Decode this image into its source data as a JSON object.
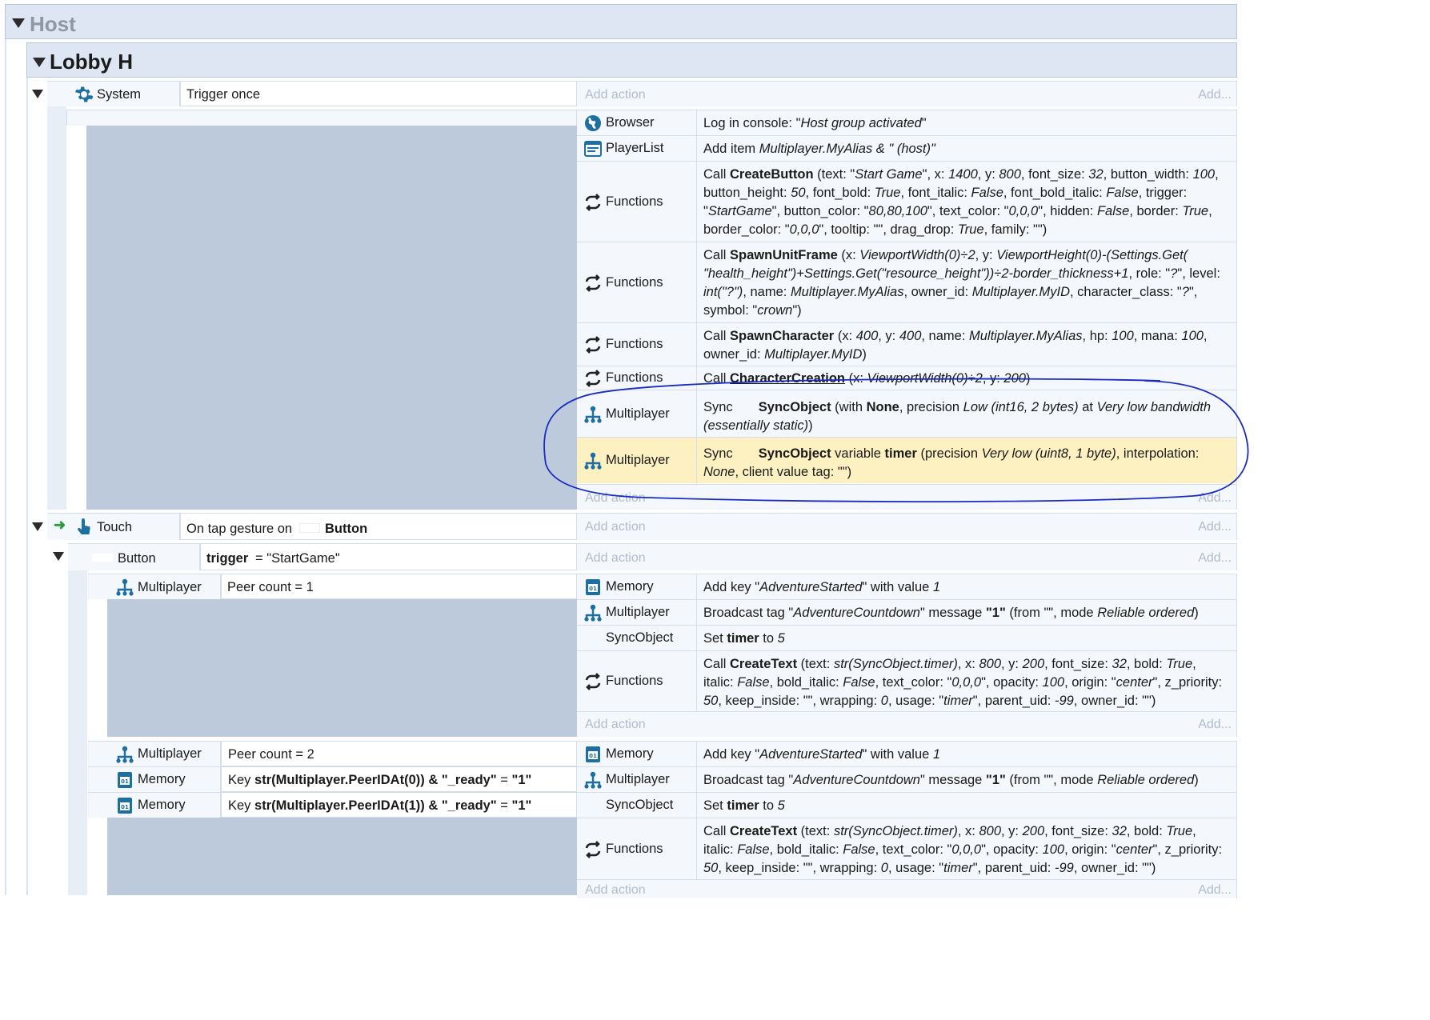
{
  "groups": {
    "host": "Host",
    "lobby": "Lobby H"
  },
  "add_action": "Add action",
  "add_short": "Add...",
  "event1": {
    "object": "System",
    "condition": "Trigger once",
    "actions": [
      {
        "object": "Browser",
        "icon": "globe-icon",
        "text": "Log in console: \"<i>Host group activated</i>\""
      },
      {
        "object": "PlayerList",
        "icon": "list-window-icon",
        "text": "Add item <i>Multiplayer.MyAlias &amp; \" (host)\"</i>"
      },
      {
        "object": "Functions",
        "icon": "functions-icon",
        "text": "Call <b>CreateButton</b> (text: \"<i>Start Game</i>\", x: <i>1400</i>, y: <i>800</i>, font_size: <i>32</i>, button_width: <i>100</i>, button_height: <i>50</i>, font_bold: <i>True</i>, font_italic: <i>False</i>, font_bold_italic: <i>False</i>, trigger: \"<i>StartGame</i>\", button_color: \"<i>80,80,100</i>\", text_color: \"<i>0,0,0</i>\", hidden: <i>False</i>, border: <i>True</i>, border_color: \"<i>0,0,0</i>\", tooltip: \"\", drag_drop: <i>True</i>, family: \"\")"
      },
      {
        "object": "Functions",
        "icon": "functions-icon",
        "text": "Call <b>SpawnUnitFrame</b> (x: <i>ViewportWidth(0)÷2</i>, y: <i>ViewportHeight(0)-(Settings.Get( \"health_height\")+Settings.Get(\"resource_height\"))÷2-border_thickness+1</i>, role: \"<i>?</i>\", level: <i>int(\"?\")</i>, name: <i>Multiplayer.MyAlias</i>, owner_id: <i>Multiplayer.MyID</i>, character_class: \"<i>?</i>\", symbol: \"<i>crown</i>\")"
      },
      {
        "object": "Functions",
        "icon": "functions-icon",
        "text": "Call <b>SpawnCharacter</b> (x: <i>400</i>, y: <i>400</i>, name: <i>Multiplayer.MyAlias</i>, hp: <i>100</i>, mana: <i>100</i>, owner_id: <i>Multiplayer.MyID</i>)"
      },
      {
        "object": "Functions",
        "icon": "functions-icon",
        "text": "Call <b><u>CharacterCreation</u></b> (x: <i>ViewportWidth(0)÷2</i>, y: <i>200</i>)"
      },
      {
        "object": "Multiplayer",
        "icon": "multiplayer-icon",
        "text": "Sync &nbsp;&nbsp;&nbsp;&nbsp;&nbsp;&nbsp;<b>SyncObject</b> (with <b>None</b>, precision <i>Low (int16, 2 bytes)</i> at <i>Very low bandwidth (essentially static)</i>)"
      },
      {
        "object": "Multiplayer",
        "icon": "multiplayer-icon",
        "text": "Sync &nbsp;&nbsp;&nbsp;&nbsp;&nbsp;&nbsp;<b>SyncObject</b> variable <b>timer</b> (precision <i>Very low (uint8, 1 byte)</i>, interpolation: <i>None</i>, client value tag: \"\")"
      }
    ]
  },
  "event2": {
    "object": "Touch",
    "condition_prefix": "On tap gesture on",
    "condition_target": "Button"
  },
  "event3": {
    "object": "Button",
    "condition_bold": "trigger",
    "condition_rest": "= \"StartGame\""
  },
  "event4": {
    "object": "Multiplayer",
    "condition": "Peer count = 1",
    "actions": [
      {
        "object": "Memory",
        "icon": "memory-icon",
        "text": "Add key \"<i>AdventureStarted</i>\" with value <i>1</i>"
      },
      {
        "object": "Multiplayer",
        "icon": "multiplayer-icon",
        "text": "Broadcast tag \"<i>AdventureCountdown</i>\" message <b>\"1\"</b> (from \"\", mode <i>Reliable ordered</i>)"
      },
      {
        "object": "SyncObject",
        "icon": "",
        "text": "Set <b>timer</b> to <i>5</i>"
      },
      {
        "object": "Functions",
        "icon": "functions-icon",
        "text": "Call <b>CreateText</b> (text: <i>str(SyncObject.timer)</i>, x: <i>800</i>, y: <i>200</i>, font_size: <i>32</i>, bold: <i>True</i>, italic: <i>False</i>, bold_italic: <i>False</i>, text_color: \"<i>0,0,0</i>\", opacity: <i>100</i>, origin: \"<i>center</i>\", z_priority: <i>50</i>, keep_inside: \"\", wrapping: <i>0</i>, usage: \"<i>timer</i>\", parent_uid: <i>-99</i>, owner_id: \"\")"
      }
    ]
  },
  "event5": {
    "conditions": [
      {
        "object": "Multiplayer",
        "icon": "multiplayer-icon",
        "text": "Peer count = 2"
      },
      {
        "object": "Memory",
        "icon": "memory-icon",
        "text": "Key <b>str(Multiplayer.PeerIDAt(0)) &amp; \"_ready\"</b> = <b>\"1\"</b>"
      },
      {
        "object": "Memory",
        "icon": "memory-icon",
        "text": "Key <b>str(Multiplayer.PeerIDAt(1)) &amp; \"_ready\"</b> = <b>\"1\"</b>"
      }
    ],
    "actions": [
      {
        "object": "Memory",
        "icon": "memory-icon",
        "text": "Add key \"<i>AdventureStarted</i>\" with value <i>1</i>"
      },
      {
        "object": "Multiplayer",
        "icon": "multiplayer-icon",
        "text": "Broadcast tag \"<i>AdventureCountdown</i>\" message <b>\"1\"</b> (from \"\", mode <i>Reliable ordered</i>)"
      },
      {
        "object": "SyncObject",
        "icon": "",
        "text": "Set <b>timer</b> to <i>5</i>"
      },
      {
        "object": "Functions",
        "icon": "functions-icon",
        "text": "Call <b>CreateText</b> (text: <i>str(SyncObject.timer)</i>, x: <i>800</i>, y: <i>200</i>, font_size: <i>32</i>, bold: <i>True</i>, italic: <i>False</i>, bold_italic: <i>False</i>, text_color: \"<i>0,0,0</i>\", opacity: <i>100</i>, origin: \"<i>center</i>\", z_priority: <i>50</i>, keep_inside: \"\", wrapping: <i>0</i>, usage: \"<i>timer</i>\", parent_uid: <i>-99</i>, owner_id: \"\")"
      }
    ]
  },
  "colors": {
    "highlight": "#fdf1c2",
    "annotation": "#1a2bc4",
    "icon": "#0f5f88"
  }
}
